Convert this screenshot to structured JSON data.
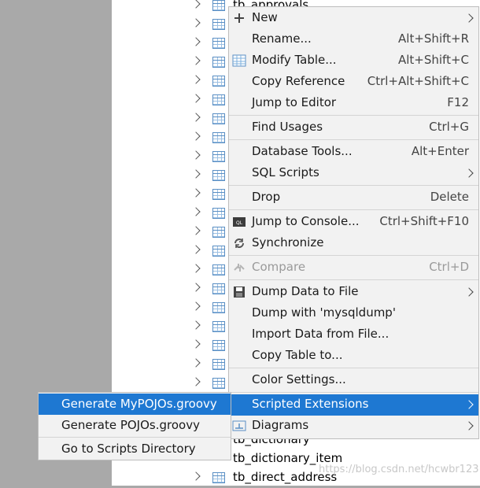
{
  "tree": {
    "rows_top": [
      "tb_approvals"
    ],
    "rows_bottom": [
      "tb_dictionary",
      "tb_dictionary_item",
      "tb_direct_address"
    ]
  },
  "context_menu": {
    "items": [
      {
        "label": "New",
        "shortcut": "",
        "icon": "plus-icon"
      },
      {
        "label": "Rename...",
        "shortcut": "Alt+Shift+R"
      },
      {
        "label": "Modify Table...",
        "shortcut": "Alt+Shift+C",
        "icon": "table-icon"
      },
      {
        "label": "Copy Reference",
        "shortcut": "Ctrl+Alt+Shift+C"
      },
      {
        "label": "Jump to Editor",
        "shortcut": "F12"
      },
      {
        "label": "Find Usages",
        "shortcut": "Ctrl+G"
      },
      {
        "label": "Database Tools...",
        "shortcut": "Alt+Enter"
      },
      {
        "label": "SQL Scripts",
        "shortcut": ""
      },
      {
        "label": "Drop",
        "shortcut": "Delete"
      },
      {
        "label": "Jump to Console...",
        "shortcut": "Ctrl+Shift+F10",
        "icon": "console-icon"
      },
      {
        "label": "Synchronize",
        "shortcut": "",
        "icon": "sync-icon"
      },
      {
        "label": "Compare",
        "shortcut": "Ctrl+D",
        "icon": "compare-icon",
        "disabled": true
      },
      {
        "label": "Dump Data to File",
        "shortcut": "",
        "icon": "save-icon"
      },
      {
        "label": "Dump with 'mysqldump'",
        "shortcut": ""
      },
      {
        "label": "Import Data from File...",
        "shortcut": ""
      },
      {
        "label": "Copy Table to...",
        "shortcut": ""
      },
      {
        "label": "Color Settings...",
        "shortcut": ""
      },
      {
        "label": "Scripted Extensions",
        "shortcut": "",
        "active": true
      },
      {
        "label": "Diagrams",
        "shortcut": "",
        "icon": "diagram-icon"
      }
    ]
  },
  "submenu": {
    "items": [
      {
        "label": "Generate MyPOJOs.groovy",
        "active": true
      },
      {
        "label": "Generate POJOs.groovy"
      },
      {
        "label": "Go to Scripts Directory"
      }
    ]
  },
  "watermark": "https://blog.csdn.net/hcwbr123",
  "colors": {
    "highlight": "#1e78d2",
    "menu_bg": "#f2f2f2"
  }
}
